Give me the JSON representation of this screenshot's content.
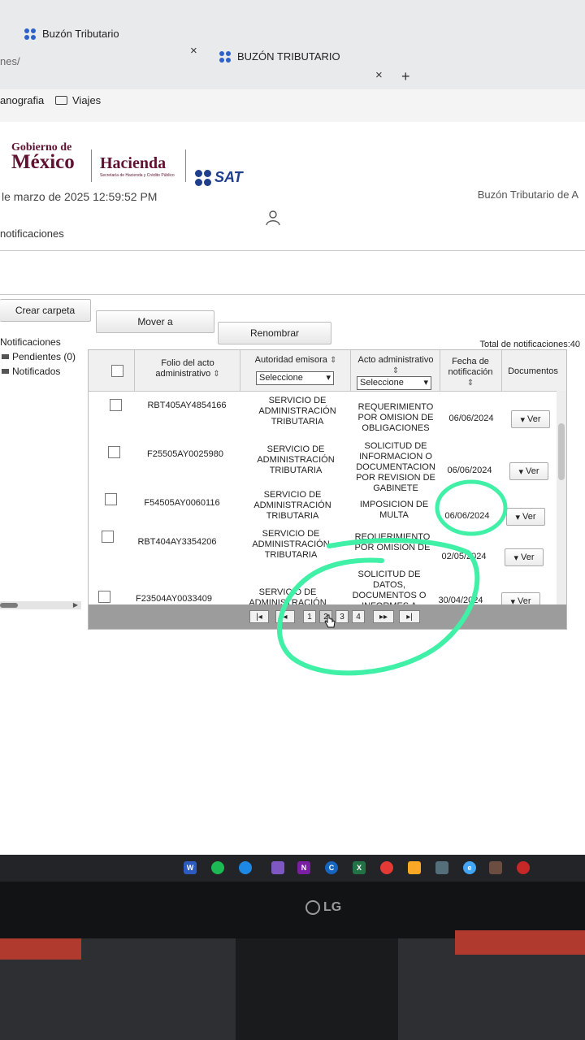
{
  "browser": {
    "tabs": [
      {
        "label": "Buzón Tributario"
      },
      {
        "label": "BUZÓN TRIBUTARIO"
      }
    ],
    "address_fragment": "nes/",
    "bookmarks": [
      {
        "label": "anografia"
      },
      {
        "label": "Viajes"
      }
    ],
    "new_tab": "+",
    "close": "×"
  },
  "header": {
    "gob_small": "Gobierno de",
    "gob_big": "México",
    "hacienda": "Hacienda",
    "hacienda_sub": "Secretaría de Hacienda y Crédito Público",
    "sat": "SAT",
    "buzon_title": "Buzón Tributario de A",
    "datetime": "le marzo de 2025 12:59:52 PM",
    "breadcrumb": "notificaciones"
  },
  "toolbar": {
    "crear_carpeta": "Crear carpeta",
    "mover_a": "Mover a",
    "renombrar": "Renombrar"
  },
  "tree": {
    "root": "Notificaciones",
    "items": [
      {
        "label": "Pendientes (0)"
      },
      {
        "label": "Notificados"
      }
    ]
  },
  "grid": {
    "total_label": "Total de notificaciones:40",
    "columns": {
      "folio": "Folio del acto administrativo",
      "autoridad": "Autoridad emisora",
      "acto": "Acto administrativo",
      "fecha": "Fecha de notificación",
      "documentos": "Documentos"
    },
    "select_placeholder": "Seleccione",
    "rows": [
      {
        "folio": "RBT405AY4854166",
        "autoridad": "SERVICIO DE ADMINISTRACIÓN TRIBUTARIA",
        "acto": "REQUERIMIENTO POR OMISION DE OBLIGACIONES",
        "fecha": "06/06/2024",
        "ver": "Ver"
      },
      {
        "folio": "F25505AY0025980",
        "autoridad": "SERVICIO DE ADMINISTRACIÓN TRIBUTARIA",
        "acto": "SOLICITUD DE INFORMACION O DOCUMENTACION POR REVISION DE GABINETE",
        "fecha": "06/06/2024",
        "ver": "Ver"
      },
      {
        "folio": "F54505AY0060116",
        "autoridad": "SERVICIO DE ADMINISTRACIÓN TRIBUTARIA",
        "acto": "IMPOSICION DE MULTA",
        "fecha": "06/06/2024",
        "ver": "Ver"
      },
      {
        "folio": "RBT404AY3354206",
        "autoridad": "SERVICIO DE ADMINISTRACIÓN TRIBUTARIA",
        "acto": "REQUERIMIENTO POR OMISION DE OBLIGACIONES",
        "fecha": "02/05/2024",
        "ver": "Ver"
      },
      {
        "folio": "F23504AY0033409",
        "autoridad": "SERVICIO DE ADMINISTRACIÓN",
        "acto": "SOLICITUD DE DATOS, DOCUMENTOS O INFORMES A",
        "fecha": "30/04/2024",
        "ver": "Ver"
      }
    ],
    "pager": {
      "first": "|◂",
      "prev": "◂",
      "pages": [
        "1",
        "2",
        "3",
        "4"
      ],
      "current_page": "2",
      "next": "▸▸",
      "last": "▸|"
    }
  },
  "monitor": {
    "brand": "LG"
  },
  "colors": {
    "annotation": "#3ff0a6",
    "gob": "#611232",
    "sat": "#1f3e8c"
  }
}
